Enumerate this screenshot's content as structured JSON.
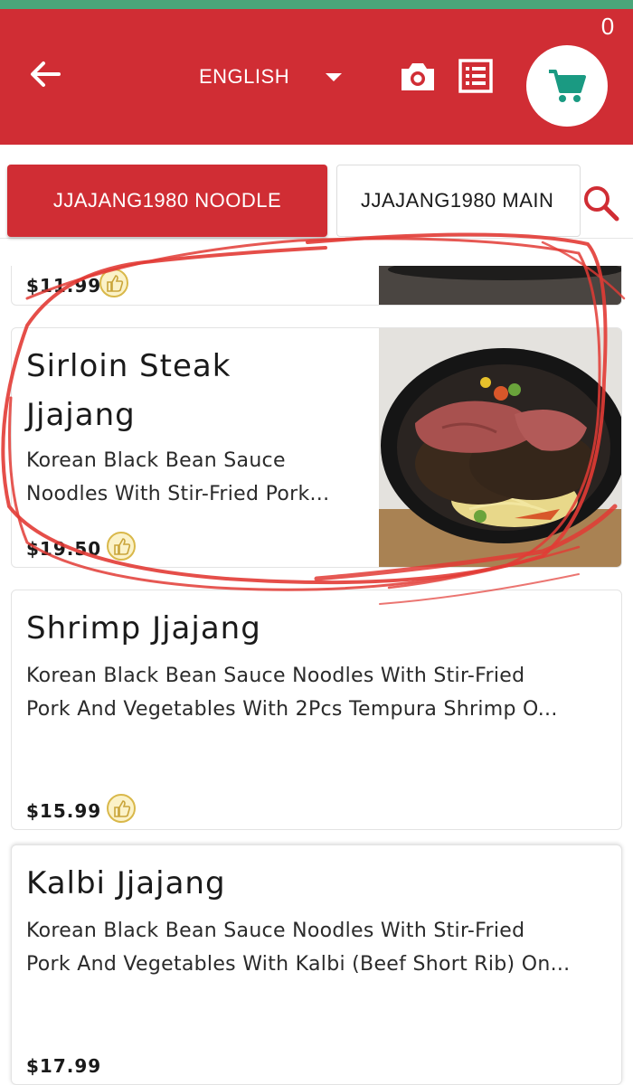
{
  "header": {
    "language": "ENGLISH",
    "cart_count": "0",
    "colors": {
      "primary": "#d02d34",
      "accent": "#1a9a82",
      "top_strip": "#4aa67a"
    },
    "icons": [
      "back-arrow-icon",
      "caret-down-icon",
      "camera-icon",
      "list-icon",
      "cart-icon"
    ]
  },
  "tabs": [
    {
      "label": "JJAJANG1980 NOODLE",
      "active": true
    },
    {
      "label": "JJAJANG1980 MAIN",
      "active": false
    }
  ],
  "items": [
    {
      "price": "$11.99"
    },
    {
      "name_line1": "Sirloin Steak",
      "name_line2": "Jjajang",
      "desc_line1": "Korean Black Bean Sauce",
      "desc_line2": "Noodles With Stir-Fried Pork...",
      "price": "$19.50"
    },
    {
      "name": "Shrimp Jjajang",
      "desc_line1": "Korean Black Bean Sauce Noodles With Stir-Fried",
      "desc_line2": "Pork And Vegetables With 2Pcs Tempura Shrimp O...",
      "price": "$15.99"
    },
    {
      "name": "Kalbi Jjajang",
      "desc_line1": "Korean Black Bean Sauce Noodles With Stir-Fried",
      "desc_line2": "Pork And Vegetables With Kalbi (Beef Short Rib) On...",
      "price": "$17.99"
    }
  ]
}
